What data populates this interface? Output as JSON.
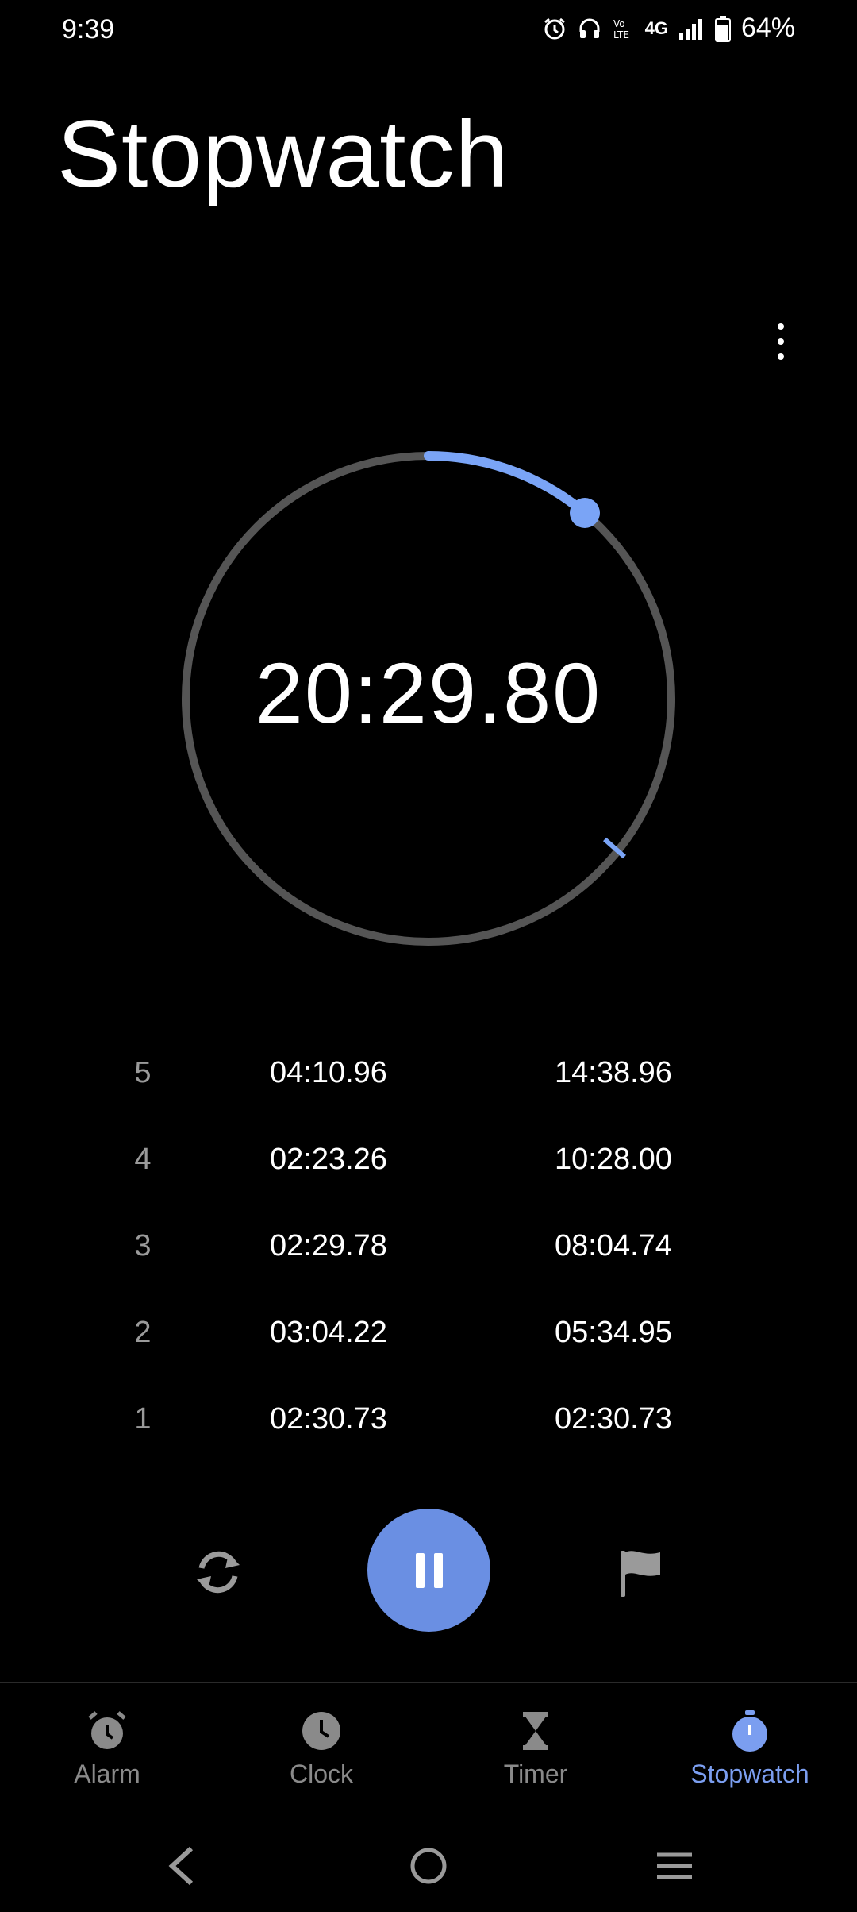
{
  "status_bar": {
    "time": "9:39",
    "network": "4G",
    "battery": "64%",
    "icons": [
      "alarm-icon",
      "headphones-icon",
      "volte-icon",
      "signal-icon",
      "battery-icon"
    ]
  },
  "header": {
    "title": "Stopwatch"
  },
  "stopwatch": {
    "elapsed": "20:29.80",
    "accent_color": "#7aa4f6",
    "ring_color": "#555555"
  },
  "laps": [
    {
      "number": "5",
      "lap_time": "04:10.96",
      "total_time": "14:38.96"
    },
    {
      "number": "4",
      "lap_time": "02:23.26",
      "total_time": "10:28.00"
    },
    {
      "number": "3",
      "lap_time": "02:29.78",
      "total_time": "08:04.74"
    },
    {
      "number": "2",
      "lap_time": "03:04.22",
      "total_time": "05:34.95"
    },
    {
      "number": "1",
      "lap_time": "02:30.73",
      "total_time": "02:30.73"
    }
  ],
  "controls": {
    "reset_icon": "reset-icon",
    "pause_icon": "pause-icon",
    "lap_icon": "flag-icon",
    "primary_color": "#6a8fe3"
  },
  "nav": {
    "items": [
      {
        "label": "Alarm",
        "icon": "alarm-icon",
        "active": false
      },
      {
        "label": "Clock",
        "icon": "clock-icon",
        "active": false
      },
      {
        "label": "Timer",
        "icon": "hourglass-icon",
        "active": false
      },
      {
        "label": "Stopwatch",
        "icon": "stopwatch-icon",
        "active": true
      }
    ],
    "active_color": "#7b9ef0",
    "inactive_color": "#8a8a8a"
  },
  "system_nav": [
    "back-icon",
    "home-icon",
    "recents-icon"
  ]
}
